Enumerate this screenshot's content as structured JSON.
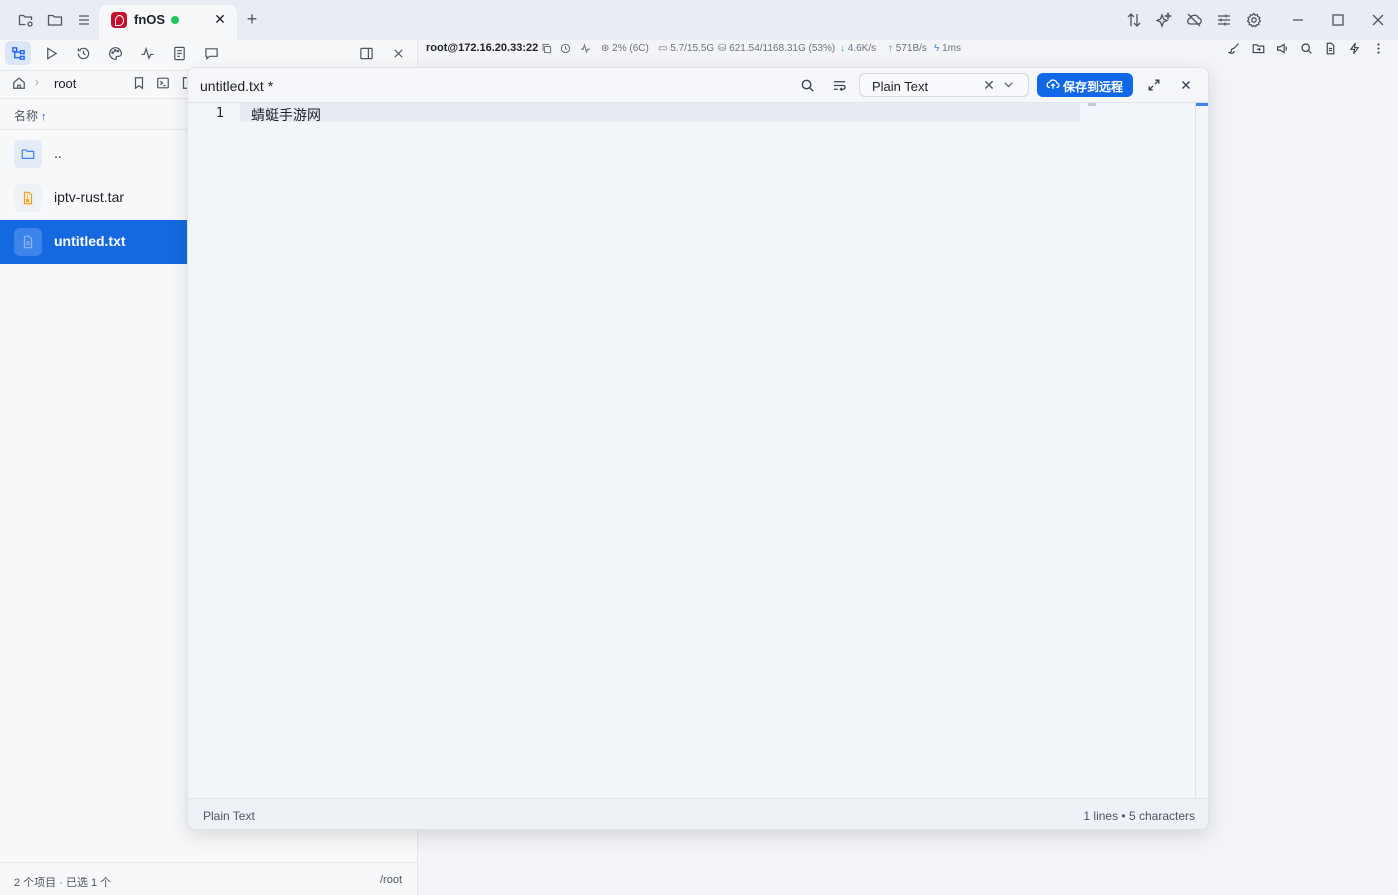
{
  "tab": {
    "title": "fnOS"
  },
  "breadcrumb": {
    "current": "root"
  },
  "file_list": {
    "column_name": "名称",
    "sort_indicator": "↑",
    "items": [
      {
        "name": ".."
      },
      {
        "name": "iptv-rust.tar"
      },
      {
        "name": "untitled.txt"
      }
    ]
  },
  "status": {
    "summary": "2 个项目 · 已选 1 个",
    "path": "/root"
  },
  "terminal": {
    "host": "root@172.16.20.33:22",
    "cpu": "2% (6C)",
    "memory": "5.7/15.5G",
    "disk": "621.54/1168.31G (53%)",
    "download": "4.6K/s",
    "upload": "571B/s",
    "latency": "1ms"
  },
  "editor": {
    "title": "untitled.txt *",
    "language": "Plain Text",
    "save_label": "保存到远程",
    "line_number": "1",
    "line_content": "蜻蜓手游网",
    "footer_language": "Plain Text",
    "footer_stats": "1 lines • 5 characters"
  }
}
